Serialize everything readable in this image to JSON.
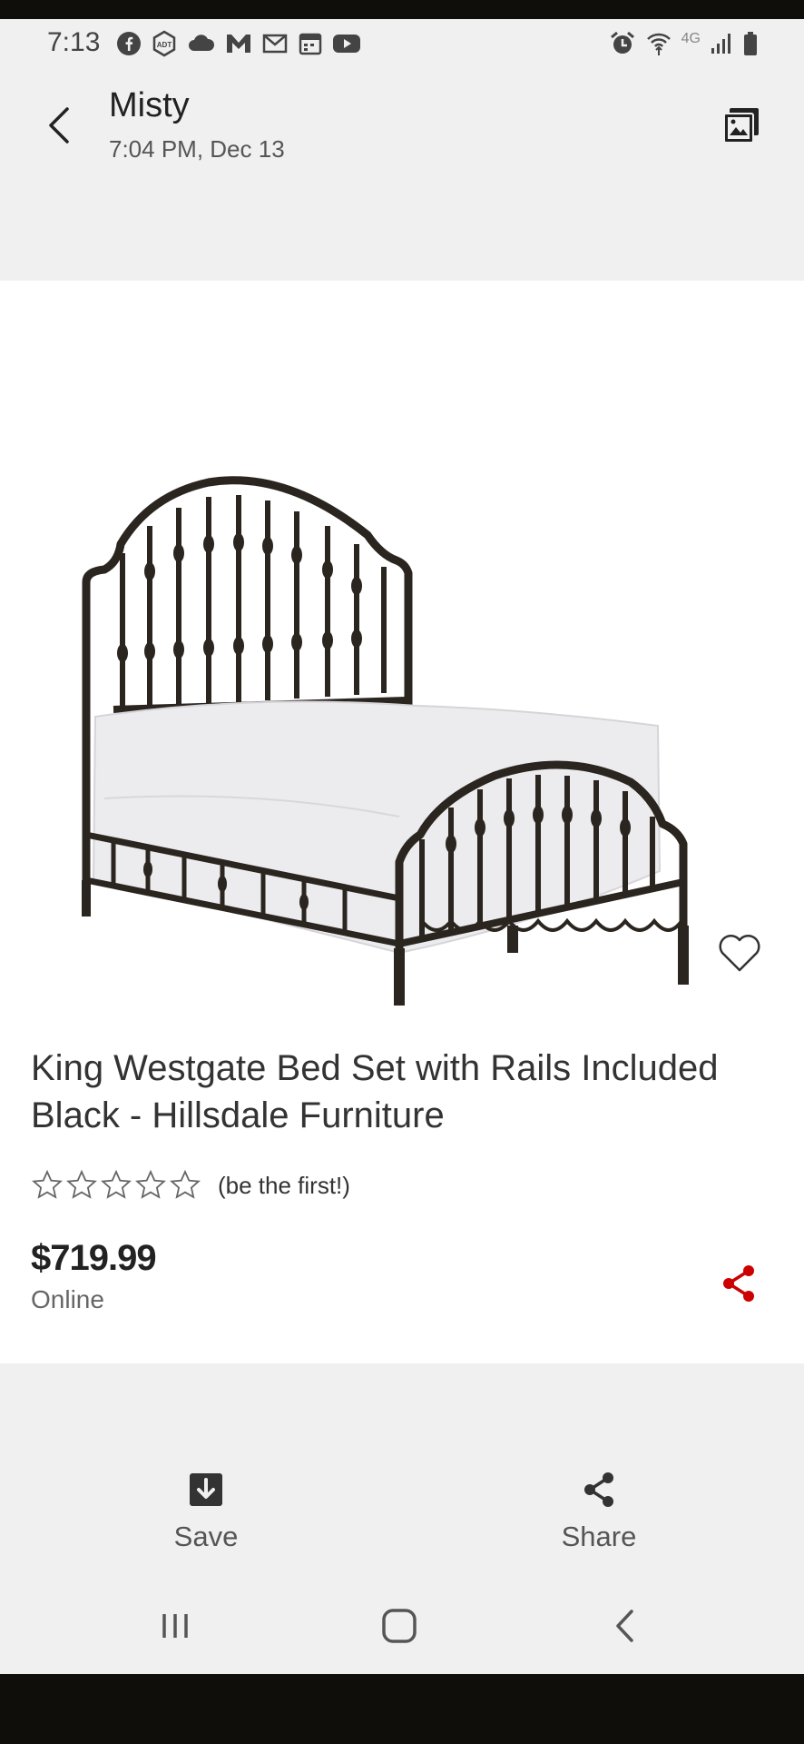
{
  "status_bar": {
    "time": "7:13",
    "notification_icons": [
      "facebook-icon",
      "adt-icon",
      "cloud-icon",
      "mail-m-icon",
      "gmail-icon",
      "calendar-icon",
      "youtube-icon"
    ],
    "system_icons": [
      "alarm-icon",
      "wifi-icon",
      "lte-icon",
      "signal-icon",
      "battery-icon"
    ],
    "network_label": "4G"
  },
  "header": {
    "sender": "Misty",
    "timestamp": "7:04 PM, Dec 13"
  },
  "product": {
    "image": "metal-bed-image",
    "title": "King Westgate Bed Set with Rails Included Black - Hillsdale Furniture",
    "rating_stars": 0,
    "rating_note": "(be the first!)",
    "price": "$719.99",
    "channel": "Online",
    "accent_color": "#cc0000"
  },
  "actions": {
    "save_label": "Save",
    "share_label": "Share"
  }
}
